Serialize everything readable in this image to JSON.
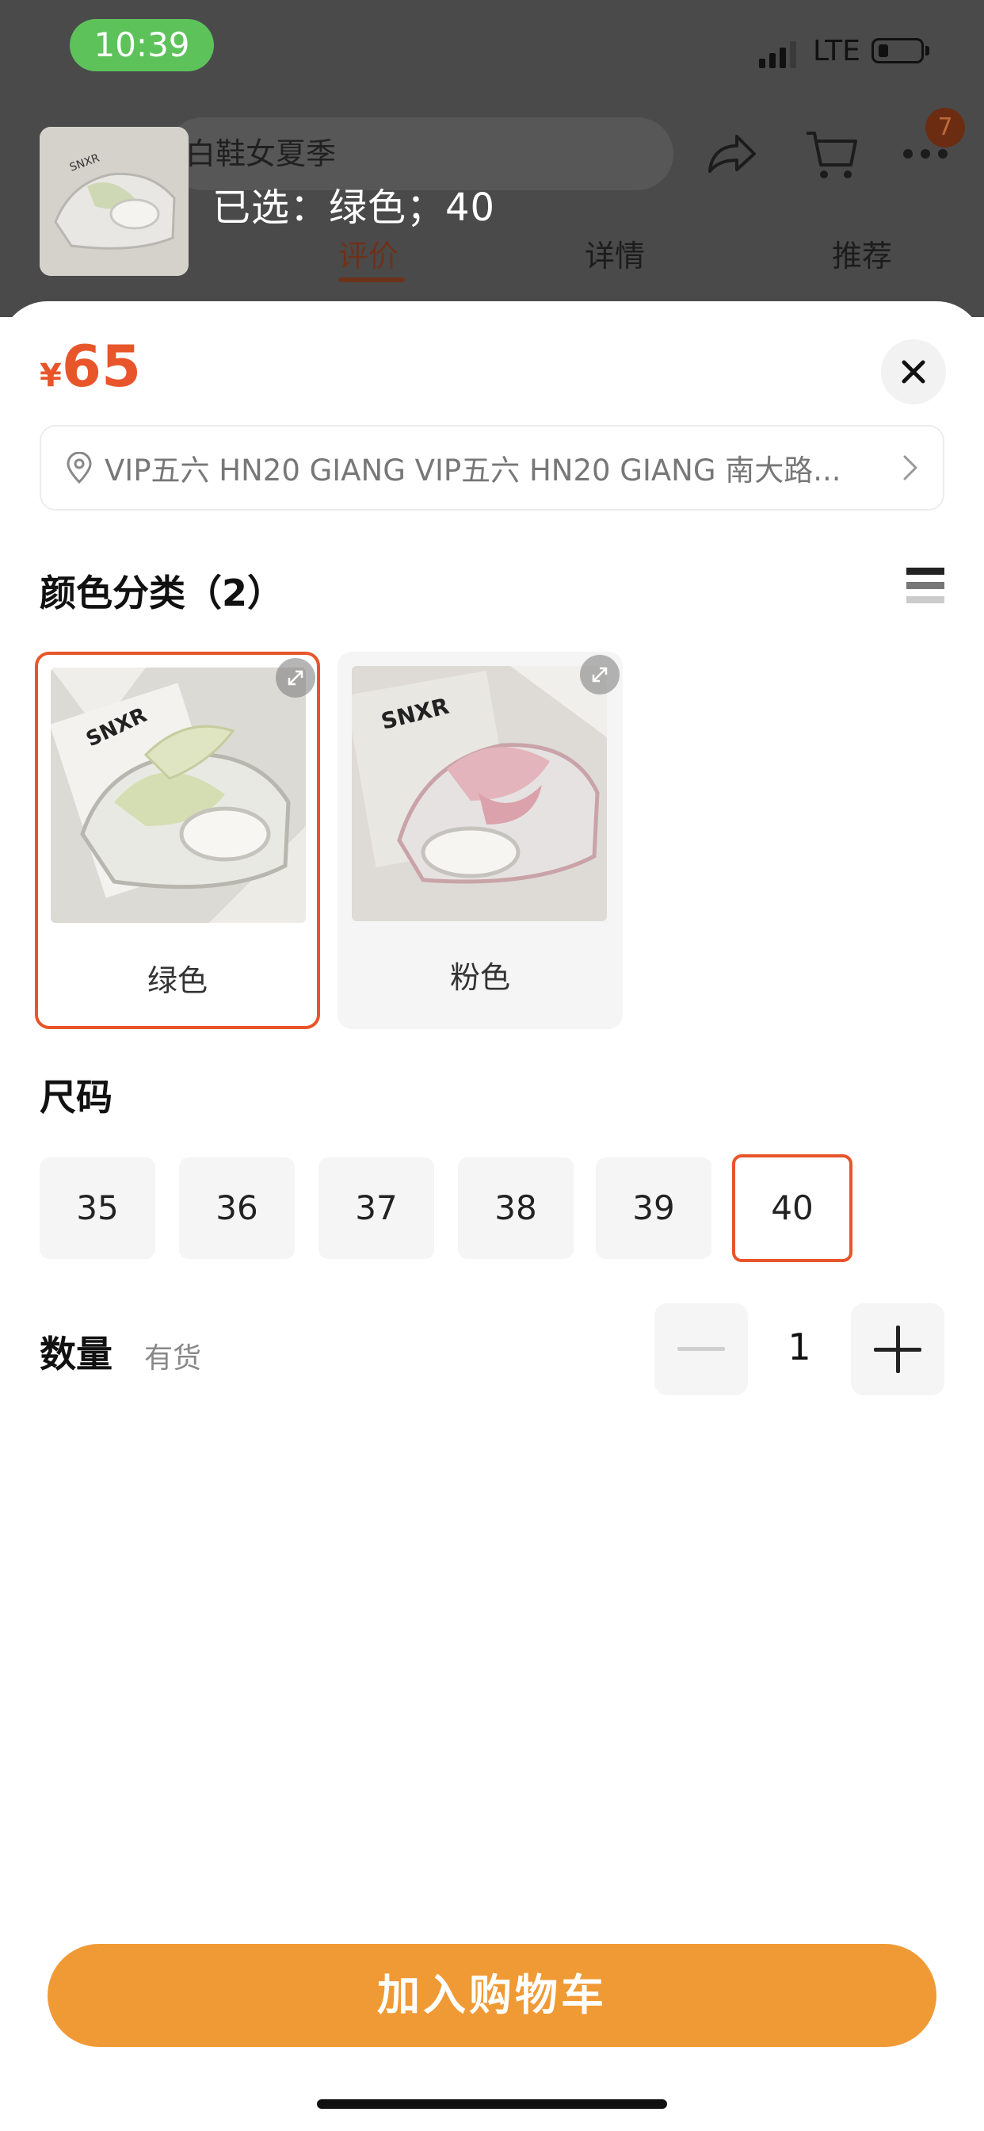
{
  "status_bar": {
    "time": "10:39",
    "network": "LTE"
  },
  "background_page": {
    "search_text": "白鞋女夏季",
    "cart_badge": "7",
    "tabs": [
      {
        "label": "评价",
        "active": true
      },
      {
        "label": "详情",
        "active": false
      },
      {
        "label": "推荐",
        "active": false
      }
    ]
  },
  "selection": {
    "summary": "已选：绿色；40"
  },
  "sheet": {
    "price_symbol": "¥",
    "price": "65",
    "address": "VIP五六 HN20 GIANG VIP五六 HN20 GIANG 南大路...",
    "color_section": {
      "title": "颜色分类（2）",
      "options": [
        {
          "label": "绿色",
          "selected": true
        },
        {
          "label": "粉色",
          "selected": false
        }
      ]
    },
    "size_section": {
      "title": "尺码",
      "options": [
        {
          "label": "35",
          "selected": false
        },
        {
          "label": "36",
          "selected": false
        },
        {
          "label": "37",
          "selected": false
        },
        {
          "label": "38",
          "selected": false
        },
        {
          "label": "39",
          "selected": false
        },
        {
          "label": "40",
          "selected": true
        }
      ]
    },
    "quantity": {
      "label": "数量",
      "stock": "有货",
      "value": "1"
    },
    "add_to_cart": "加入购物车"
  },
  "colors": {
    "accent": "#e8552a",
    "cta": "#f09a35",
    "status_pill": "#5ec25b"
  }
}
